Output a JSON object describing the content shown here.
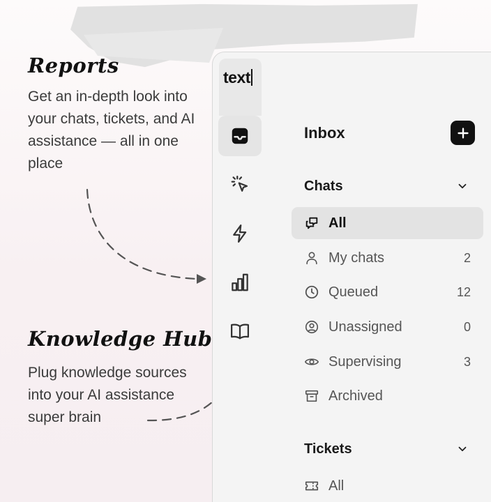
{
  "features": [
    {
      "title": "Reports",
      "description": "Get an in-depth look into your chats, tickets, and AI assistance — all in one place"
    },
    {
      "title": "Knowledge Hub",
      "description": "Plug knowledge sources into your AI assistance super brain"
    }
  ],
  "app": {
    "logo_text": "text",
    "rail": [
      {
        "icon": "inbox-icon",
        "active": true
      },
      {
        "icon": "sparkle-cursor-icon",
        "active": false
      },
      {
        "icon": "lightning-icon",
        "active": false
      },
      {
        "icon": "bar-chart-icon",
        "active": false
      },
      {
        "icon": "book-icon",
        "active": false
      }
    ],
    "inbox": {
      "title": "Inbox",
      "add_icon": "plus-icon",
      "chats": {
        "label": "Chats",
        "items": [
          {
            "label": "All",
            "icon": "chat-bubbles-icon",
            "count": "",
            "selected": true
          },
          {
            "label": "My chats",
            "icon": "person-icon",
            "count": "2"
          },
          {
            "label": "Queued",
            "icon": "clock-icon",
            "count": "12"
          },
          {
            "label": "Unassigned",
            "icon": "user-circle-icon",
            "count": "0"
          },
          {
            "label": "Supervising",
            "icon": "eye-icon",
            "count": "3"
          },
          {
            "label": "Archived",
            "icon": "archive-icon",
            "count": ""
          }
        ]
      },
      "tickets": {
        "label": "Tickets",
        "items": [
          {
            "label": "All",
            "icon": "ticket-icon",
            "count": ""
          }
        ]
      }
    }
  },
  "colors": {
    "accent": "#111111",
    "selected_bg": "#e3e3e3",
    "panel_bg": "#f4f4f4"
  }
}
